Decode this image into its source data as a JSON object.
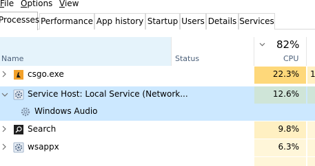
{
  "menu": {
    "file": "File",
    "options": "Options",
    "view": "View"
  },
  "tabs": [
    {
      "label": "Processes",
      "active": true
    },
    {
      "label": "Performance"
    },
    {
      "label": "App history"
    },
    {
      "label": "Startup"
    },
    {
      "label": "Users"
    },
    {
      "label": "Details"
    },
    {
      "label": "Services"
    }
  ],
  "columns": {
    "name": "Name",
    "status": "Status",
    "cpu_percent": "82%",
    "cpu_label": "CPU"
  },
  "rows": [
    {
      "name": "csgo.exe",
      "cpu": "22.3%",
      "next": "1,",
      "icon": "csgo-icon",
      "expanded": false
    },
    {
      "name": "Service Host: Local Service (Network...",
      "cpu": "12.6%",
      "icon": "gear-icon",
      "expanded": true,
      "selected": true
    },
    {
      "name": "Windows Audio",
      "icon": "gear-icon",
      "child": true,
      "selected": true
    },
    {
      "name": "Search",
      "cpu": "9.8%",
      "icon": "search-icon",
      "expanded": false
    },
    {
      "name": "wsappx",
      "cpu": "6.3%",
      "icon": "gear-icon",
      "expanded": false
    }
  ],
  "colors": {
    "cpu_high": "#fed87a",
    "cpu_mid": "#fff0c2",
    "cpu_low": "#fff6d9",
    "selected": "#cce8ff",
    "header_hover": "#e5f3fb"
  }
}
